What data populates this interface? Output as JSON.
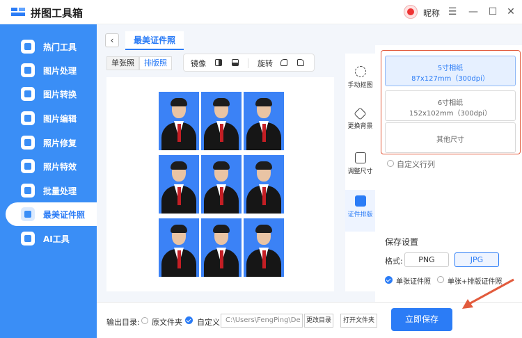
{
  "app": {
    "title": "拼图工具箱",
    "nickname": "昵称"
  },
  "window": {
    "menu_glyph": "☰",
    "min_glyph": "—",
    "max_glyph": "☐",
    "close_glyph": "✕"
  },
  "sidebar": {
    "items": [
      {
        "label": "热门工具",
        "icon": "tools-icon"
      },
      {
        "label": "图片处理",
        "icon": "image-icon"
      },
      {
        "label": "图片转换",
        "icon": "image-convert-icon"
      },
      {
        "label": "图片编辑",
        "icon": "image-edit-icon"
      },
      {
        "label": "照片修复",
        "icon": "camera-icon"
      },
      {
        "label": "照片特效",
        "icon": "camera-effect-icon"
      },
      {
        "label": "批量处理",
        "icon": "batch-icon"
      },
      {
        "label": "最美证件照",
        "icon": "person-icon"
      },
      {
        "label": "AI工具",
        "icon": "ai-icon"
      }
    ],
    "active_index": 7
  },
  "page": {
    "back": "‹",
    "title": "最美证件照"
  },
  "mode_tabs": [
    {
      "label": "单张照"
    },
    {
      "label": "排版照"
    }
  ],
  "toolbar": {
    "mirror_label": "镜像",
    "rotate_label": "旋转"
  },
  "tools": [
    {
      "label": "手动抠图"
    },
    {
      "label": "更换背景"
    },
    {
      "label": "调整尺寸"
    },
    {
      "label": "证件排版"
    }
  ],
  "paper_options": [
    {
      "name": "5寸相纸",
      "size": "87x127mm（300dpi）"
    },
    {
      "name": "6寸相纸",
      "size": "152x102mm（300dpi）"
    },
    {
      "name": "其他尺寸",
      "size": ""
    }
  ],
  "custom_rows_label": "自定义行列",
  "save_settings": {
    "title": "保存设置",
    "format_label": "格式:",
    "formats": [
      "PNG",
      "JPG"
    ],
    "selected_format": "JPG",
    "single_label": "单张证件照",
    "combo_label": "单张+排版证件照"
  },
  "output": {
    "label": "输出目录:",
    "original_label": "原文件夹",
    "custom_label": "自定义",
    "path": "C:\\Users\\FengPing\\De",
    "change_label": "更改目录",
    "open_label": "打开文件夹"
  },
  "save_button": "立即保存",
  "colors": {
    "accent": "#2b7cf6",
    "sidebar": "#3a8ef6",
    "photo_bg": "#3b82f6",
    "highlight": "#e25b3d"
  }
}
